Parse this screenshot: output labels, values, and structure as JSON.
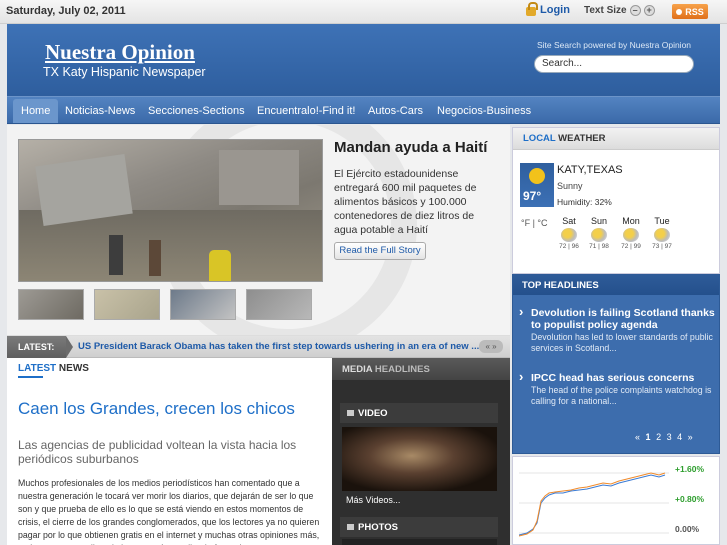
{
  "topbar": {
    "date": "Saturday, July 02, 2011",
    "login": "Login",
    "text_size": "Text Size",
    "rss": "RSS"
  },
  "header": {
    "site_title": "Nuestra Opinion",
    "tagline": "TX Katy Hispanic Newspaper",
    "search_label": "Site Search powered by Nuestra Opinion",
    "search_value": "Search..."
  },
  "nav": {
    "items": [
      "Home",
      "Noticias-News",
      "Secciones-Sections",
      "Encuentralo!-Find it!",
      "Autos-Cars",
      "Negocios-Business"
    ]
  },
  "feature": {
    "headline": "Mandan ayuda a Haití",
    "summary": "El Ejército estadounidense entregará 600 mil paquetes de alimentos básicos y 100.000 contenedores de diez litros de agua potable a Haití",
    "read_more": "Read the Full Story"
  },
  "ticker": {
    "label": "LATEST:",
    "text": "US President Barack Obama has taken the first step towards ushering in an era of new ...",
    "nav": "« »"
  },
  "latest_news": {
    "header_hl": "LATEST",
    "header_rest": " NEWS",
    "title": "Caen los Grandes, crecen los chicos",
    "subtitle": "Las agencias de publicidad voltean la vista hacia los periódicos suburbanos",
    "body": "Muchos profesionales de los medios periodísticos han comentado que a nuestra generación le tocará ver morir los diarios, que dejarán de ser lo que son y que prueba de ello es lo que se está viendo en estos momentos de crisis, el cierre de los grandes conglomerados, que los lectores ya no quieren pagar por lo que obtienen gratis en el internet y muchas otras opiniones más, recientemente analizando lo que está sucediendo fuera de"
  },
  "media": {
    "header_hl": "MEDIA",
    "header_rest": " HEADLINES",
    "video_label": "VIDEO",
    "more_videos": "Más Videos...",
    "photos_label": "PHOTOS"
  },
  "weather": {
    "header_hl": "LOCAL",
    "header_rest": " WEATHER",
    "temp": "97°",
    "city": "KATY,TEXAS",
    "condition": "Sunny",
    "humidity": "Humidity: 32%",
    "units": "°F | °C",
    "forecast": [
      {
        "day": "Sat",
        "hilo": "72 | 96"
      },
      {
        "day": "Sun",
        "hilo": "71 | 98"
      },
      {
        "day": "Mon",
        "hilo": "72 | 99"
      },
      {
        "day": "Tue",
        "hilo": "73 | 97"
      }
    ]
  },
  "top_headlines": {
    "header": "TOP HEADLINES",
    "items": [
      {
        "title": "Devolution is failing Scotland thanks to populist policy agenda",
        "desc": "Devolution has led to lower standards of public services in Scotland..."
      },
      {
        "title": "IPCC head has serious concerns",
        "desc": "The head of the police complaints watchdog is calling for a national..."
      }
    ],
    "pager": [
      "«",
      "1",
      "2",
      "3",
      "4",
      "»"
    ]
  },
  "market": {
    "labels": [
      "+1.60%",
      "+0.80%",
      "0.00%"
    ],
    "colors": {
      "up": "#2e9e2e",
      "zero": "#555555",
      "line1": "#f08a2a",
      "line2": "#3a7bd5"
    }
  }
}
